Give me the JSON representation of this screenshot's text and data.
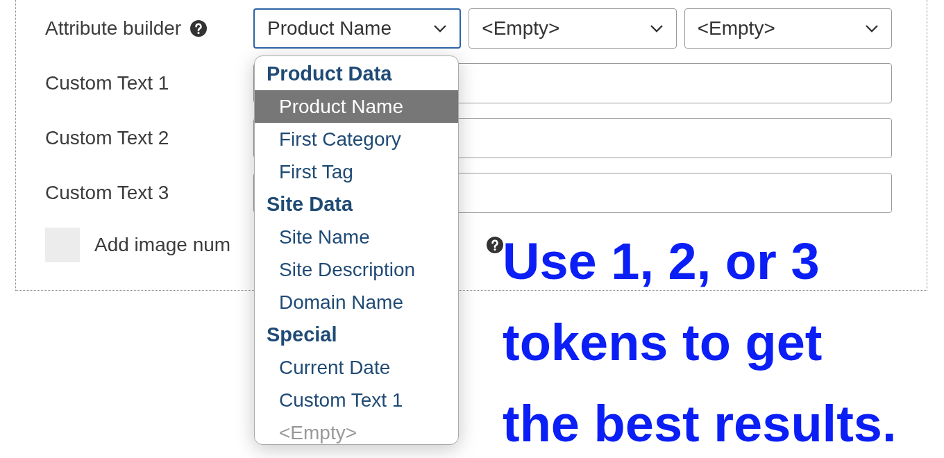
{
  "form": {
    "rows": [
      {
        "kind": "selects",
        "label": "Attribute builder",
        "help": true,
        "selects": [
          {
            "value": "Product Name",
            "focused": true
          },
          {
            "value": "<Empty>",
            "focused": false
          },
          {
            "value": "<Empty>",
            "focused": false
          }
        ]
      },
      {
        "kind": "text",
        "label": "Custom Text 1"
      },
      {
        "kind": "text",
        "label": "Custom Text 2"
      },
      {
        "kind": "text",
        "label": "Custom Text 3"
      },
      {
        "kind": "checkbox",
        "label": "Add image num",
        "checked": false,
        "help": true
      }
    ]
  },
  "dropdown": {
    "items": [
      {
        "kind": "group",
        "label": "Product Data"
      },
      {
        "kind": "option",
        "label": "Product Name",
        "selected": true
      },
      {
        "kind": "option",
        "label": "First Category",
        "selected": false
      },
      {
        "kind": "option",
        "label": "First Tag",
        "selected": false
      },
      {
        "kind": "group",
        "label": "Site Data"
      },
      {
        "kind": "option",
        "label": "Site Name",
        "selected": false
      },
      {
        "kind": "option",
        "label": "Site Description",
        "selected": false
      },
      {
        "kind": "option",
        "label": "Domain Name",
        "selected": false
      },
      {
        "kind": "group",
        "label": "Special"
      },
      {
        "kind": "option",
        "label": "Current Date",
        "selected": false
      },
      {
        "kind": "option",
        "label": "Custom Text 1",
        "selected": false
      },
      {
        "kind": "empty",
        "label": "<Empty>",
        "selected": false
      }
    ]
  },
  "note": "Use 1, 2, or 3\ntokens to get\nthe best results."
}
